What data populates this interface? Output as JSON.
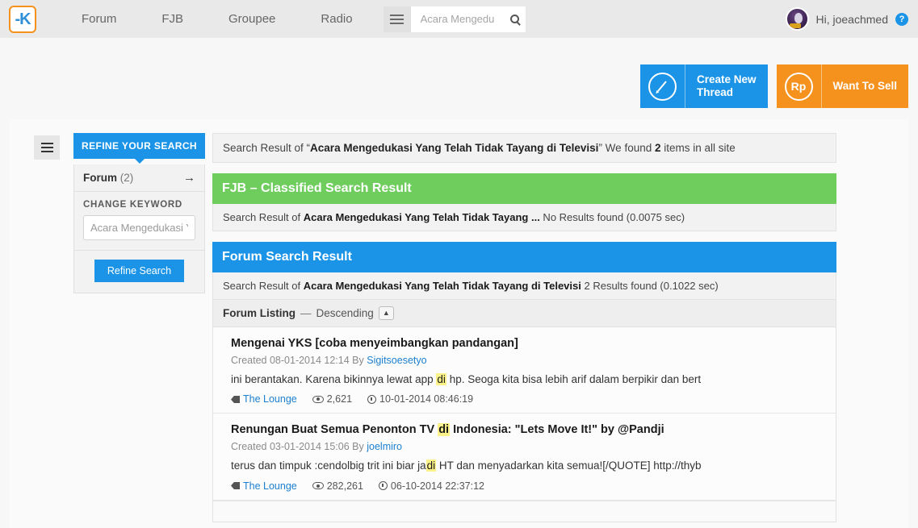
{
  "header": {
    "logo_alt": "Kaskus K logo",
    "nav": [
      {
        "label": "Forum"
      },
      {
        "label": "FJB"
      },
      {
        "label": "Groupee"
      },
      {
        "label": "Radio"
      }
    ],
    "search": {
      "placeholder": "Acara Mengedu",
      "value": ""
    },
    "user": {
      "greeting": "Hi, joeachmed",
      "help_label": "?"
    }
  },
  "actions": [
    {
      "label": "Create New\nThread",
      "icon": "pencil-icon",
      "color": "#1b94e8"
    },
    {
      "label": "Want To Sell",
      "icon": "rupiah-icon",
      "glyph": "Rp",
      "color": "#f5921e"
    }
  ],
  "sidebar": {
    "tab_label": "REFINE YOUR SEARCH",
    "forum_row": {
      "label": "Forum",
      "count": "(2)",
      "arrow": "→"
    },
    "change_keyword_label": "CHANGE KEYWORD",
    "keyword_input": {
      "placeholder": "Acara Mengedukasi Y",
      "value": ""
    },
    "refine_button": "Refine Search"
  },
  "summary": {
    "prefix": "Search Result of “",
    "query": "Acara Mengedukasi Yang Telah Tidak Tayang di Televisi",
    "middle": "” We found ",
    "count": "2",
    "suffix": " items in all site"
  },
  "fjb_panel": {
    "title": "FJB – Classified Search Result",
    "sub_prefix": "Search Result of ",
    "sub_query": "Acara Mengedukasi Yang Telah Tidak Tayang ...",
    "sub_suffix": " No Results found (0.0075 sec)"
  },
  "forum_panel": {
    "title": "Forum Search Result",
    "sub_prefix": "Search Result of ",
    "sub_query": "Acara Mengedukasi Yang Telah Tidak Tayang di Televisi",
    "sub_suffix": " 2 Results found (0.1022 sec)",
    "listing_label": "Forum Listing",
    "listing_dash": "—",
    "listing_order": "Descending",
    "sort_toggle_glyph": "▲"
  },
  "results": [
    {
      "title_before": "Mengenai YKS [coba menyeimbangkan pandangan]",
      "title_highlight": "",
      "title_after": "",
      "created_label": "Created",
      "created_date": "08-01-2014 12:14",
      "by_label": "By",
      "author": "Sigitsoesetyo",
      "snippet_before": "ini berantakan. Karena bikinnya lewat app ",
      "snippet_highlight": "di",
      "snippet_after": " hp. Seoga kita bisa lebih arif dalam berpikir dan bert",
      "forum": "The Lounge",
      "views": "2,621",
      "timestamp": "10-01-2014 08:46:19"
    },
    {
      "title_before": "Renungan Buat Semua Penonton TV ",
      "title_highlight": "di",
      "title_after": " Indonesia: \"Lets Move It!\" by @Pandji",
      "created_label": "Created",
      "created_date": "03-01-2014 15:06",
      "by_label": "By",
      "author": "joelmiro",
      "snippet_before": "terus dan timpuk :cendolbig trit ini biar ja",
      "snippet_highlight": "di",
      "snippet_after": " HT dan menyadarkan kita semua![/QUOTE] http://thyb",
      "forum": "The Lounge",
      "views": "282,261",
      "timestamp": "06-10-2014 22:37:12"
    }
  ],
  "colors": {
    "brand_blue": "#1b94e8",
    "brand_orange": "#f5921e",
    "fjb_green": "#6ecd5d",
    "highlight_yellow": "#fbf28a",
    "link_blue": "#1b7fd0"
  }
}
